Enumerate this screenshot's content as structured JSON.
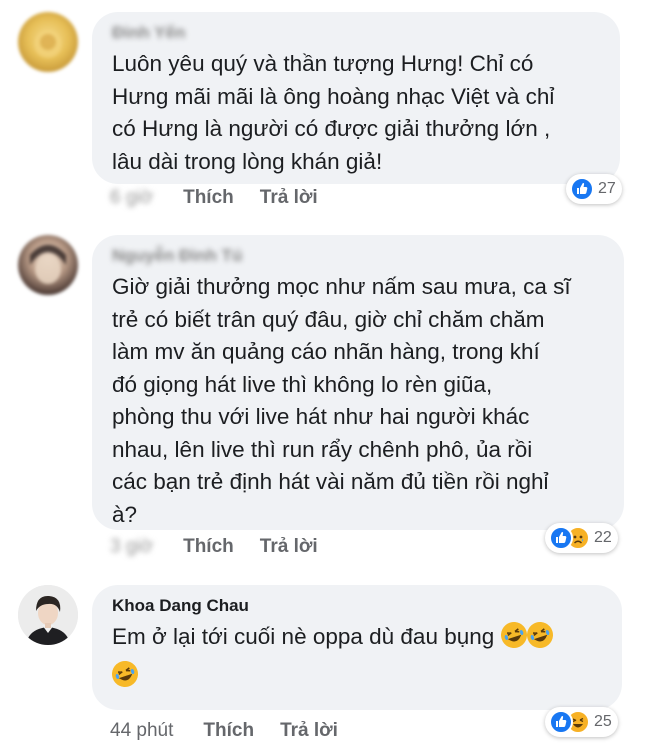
{
  "comments": [
    {
      "author": "Đinh Yến",
      "author_blurred": true,
      "lines": [
        "Luôn yêu quý và thần tượng Hưng!  Chỉ có",
        "Hưng mãi mãi là ông hoàng nhạc Việt và chỉ",
        "có Hưng là người có được giải thưởng lớn ,",
        "lâu dài trong lòng khán giả!"
      ],
      "time": "6 giờ",
      "time_blurred": true,
      "like_label": "Thích",
      "reply_label": "Trả lời",
      "reactions": [
        "like"
      ],
      "reaction_count": "27"
    },
    {
      "author": "Nguyễn Đình Tú",
      "author_blurred": true,
      "lines": [
        "Giờ giải thưởng mọc như nấm sau mưa, ca sĩ",
        "trẻ có biết trân quý đâu, giờ chỉ chăm chăm",
        "làm mv ăn quảng cáo nhãn hàng, trong khí",
        "đó giọng hát live thì không lo rèn giũa,",
        "phòng thu với live hát như hai người khác",
        "nhau, lên live thì run rẩy chênh phô, ủa rồi",
        "các bạn trẻ định hát vài năm đủ tiền rồi nghỉ",
        "à?"
      ],
      "time": "3 giờ",
      "time_blurred": true,
      "like_label": "Thích",
      "reply_label": "Trả lời",
      "reactions": [
        "like",
        "sad"
      ],
      "reaction_count": "22"
    },
    {
      "author": "Khoa Dang Chau",
      "author_blurred": false,
      "lines": [
        "Em ở lại tới cuối nè oppa dù đau bụng"
      ],
      "trailing_emoji": [
        "rofl-emoji",
        "rofl-emoji"
      ],
      "extra_emoji_line": [
        "rofl-emoji"
      ],
      "time": "44 phút",
      "time_blurred": false,
      "like_label": "Thích",
      "reply_label": "Trả lời",
      "reactions": [
        "like",
        "haha"
      ],
      "reaction_count": "25"
    }
  ],
  "colors": {
    "bubble": "#f0f2f5",
    "like_blue": "#1877f2",
    "emoji_yellow": "#f7b125",
    "meta_gray": "#65676b"
  }
}
